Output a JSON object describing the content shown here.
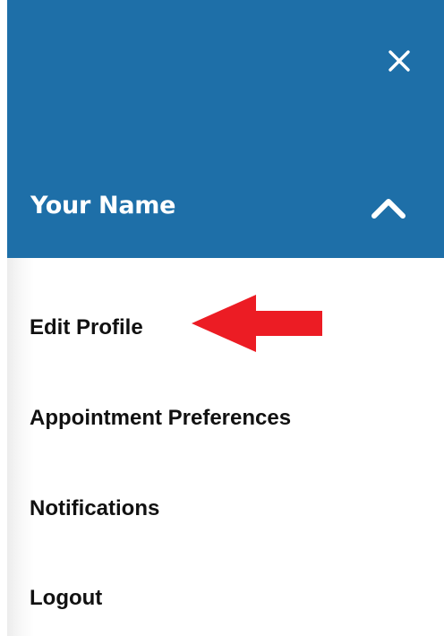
{
  "header": {
    "user_name": "Your Name",
    "background_color": "#1e6fa8",
    "close_icon": "close-icon",
    "expand_icon": "chevron-up-icon"
  },
  "menu": {
    "items": [
      {
        "label": "Edit Profile"
      },
      {
        "label": "Appointment Preferences"
      },
      {
        "label": "Notifications"
      },
      {
        "label": "Logout"
      }
    ]
  },
  "annotation": {
    "icon": "left-arrow-icon",
    "color": "#ec1c24"
  }
}
